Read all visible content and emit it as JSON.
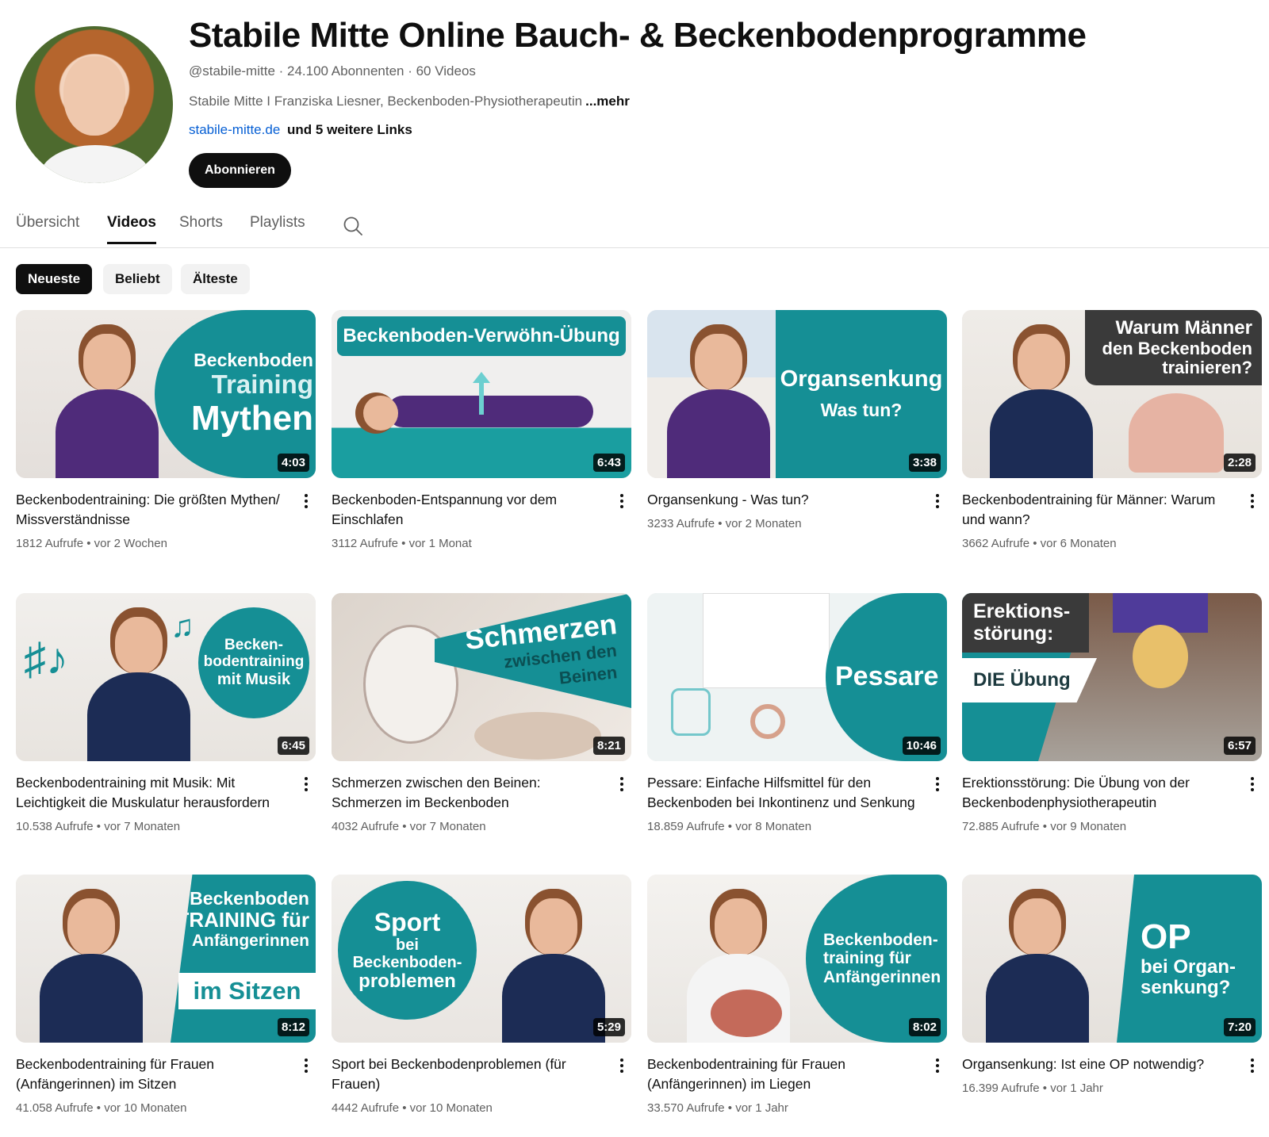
{
  "channel": {
    "title": "Stabile Mitte Online Bauch- & Beckenbodenprogramme",
    "meta": "@stabile-mitte · 24.100 Abonnenten · 60 Videos",
    "description": "Stabile Mitte I Franziska Liesner, Beckenboden-Physiotherapeutin",
    "more_label": "...mehr",
    "link": "stabile-mitte.de",
    "more_links": "und 5 weitere Links",
    "subscribe_label": "Abonnieren"
  },
  "tabs": [
    {
      "label": "Übersicht"
    },
    {
      "label": "Videos"
    },
    {
      "label": "Shorts"
    },
    {
      "label": "Playlists"
    }
  ],
  "chips": [
    {
      "label": "Neueste"
    },
    {
      "label": "Beliebt"
    },
    {
      "label": "Älteste"
    }
  ],
  "videos": [
    {
      "title": "Beckenbodentraining: Die größten Mythen/ Missverständnisse",
      "views": "1812 Aufrufe",
      "age": "vor 2 Wochen",
      "duration": "4:03",
      "thumb_text": [
        "Beckenboden",
        "Training",
        "Mythen"
      ]
    },
    {
      "title": "Beckenboden-Entspannung vor dem Einschlafen",
      "views": "3112 Aufrufe",
      "age": "vor 1 Monat",
      "duration": "6:43",
      "thumb_text": [
        "Beckenboden-Verwöhn-Übung"
      ]
    },
    {
      "title": "Organsenkung - Was tun?",
      "views": "3233 Aufrufe",
      "age": "vor 2 Monaten",
      "duration": "3:38",
      "thumb_text": [
        "Organsenkung",
        "Was tun?"
      ]
    },
    {
      "title": "Beckenbodentraining für Männer: Warum und wann?",
      "views": "3662 Aufrufe",
      "age": "vor 6 Monaten",
      "duration": "2:28",
      "thumb_text": [
        "Warum Männer",
        "den Beckenboden",
        "trainieren?"
      ]
    },
    {
      "title": "Beckenbodentraining mit Musik: Mit Leichtigkeit die Muskulatur herausfordern",
      "views": "10.538 Aufrufe",
      "age": "vor 7 Monaten",
      "duration": "6:45",
      "thumb_text": [
        "Becken-",
        "bodentraining",
        "mit Musik"
      ]
    },
    {
      "title": "Schmerzen zwischen den Beinen: Schmerzen im Beckenboden",
      "views": "4032 Aufrufe",
      "age": "vor 7 Monaten",
      "duration": "8:21",
      "thumb_text": [
        "Schmerzen",
        "zwischen den",
        "Beinen"
      ]
    },
    {
      "title": "Pessare: Einfache Hilfsmittel für den Beckenboden bei Inkontinenz und Senkung",
      "views": "18.859 Aufrufe",
      "age": "vor 8 Monaten",
      "duration": "10:46",
      "thumb_text": [
        "Pessare"
      ]
    },
    {
      "title": "Erektionsstörung: Die Übung von der Beckenbodenphysiotherapeutin",
      "views": "72.885 Aufrufe",
      "age": "vor 9 Monaten",
      "duration": "6:57",
      "thumb_text": [
        "Erektions-",
        "störung:",
        "DIE Übung"
      ]
    },
    {
      "title": "Beckenbodentraining für Frauen (Anfängerinnen) im Sitzen",
      "views": "41.058 Aufrufe",
      "age": "vor 10 Monaten",
      "duration": "8:12",
      "thumb_text": [
        "Beckenboden",
        "TRAINING für",
        "Anfängerinnen",
        "im Sitzen"
      ]
    },
    {
      "title": "Sport bei Beckenbodenproblemen (für Frauen)",
      "views": "4442 Aufrufe",
      "age": "vor 10 Monaten",
      "duration": "5:29",
      "thumb_text": [
        "Sport",
        "bei",
        "Beckenboden-",
        "problemen"
      ]
    },
    {
      "title": "Beckenbodentraining für Frauen (Anfängerinnen) im Liegen",
      "views": "33.570 Aufrufe",
      "age": "vor 1 Jahr",
      "duration": "8:02",
      "thumb_text": [
        "Beckenboden-",
        "training für",
        "Anfängerinnen"
      ]
    },
    {
      "title": "Organsenkung: Ist eine OP notwendig?",
      "views": "16.399 Aufrufe",
      "age": "vor 1 Jahr",
      "duration": "7:20",
      "thumb_text": [
        "OP",
        "bei Organ-",
        "senkung?"
      ]
    }
  ],
  "colors": {
    "teal": "#158f95",
    "purple_shirt": "#4f2b7a",
    "navy_shirt": "#1c2c55",
    "link": "#065fd4"
  }
}
